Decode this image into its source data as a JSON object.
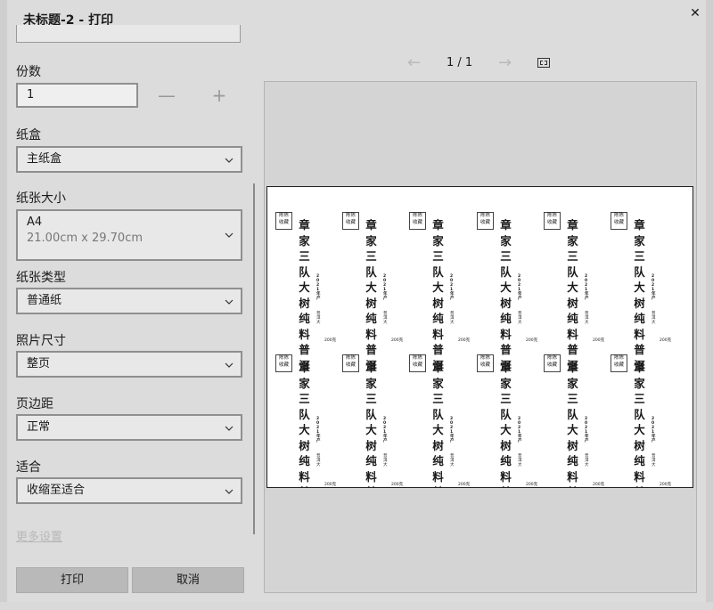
{
  "window": {
    "title": "未标题-2 - 打印",
    "close_glyph": "✕"
  },
  "settings": {
    "copies": {
      "label": "份数",
      "value": "1",
      "minus": "—",
      "plus": "+"
    },
    "tray": {
      "label": "纸盒",
      "value": "主纸盒"
    },
    "paper_size": {
      "label": "纸张大小",
      "value": "A4",
      "sub": "21.00cm x 29.70cm"
    },
    "paper_type": {
      "label": "纸张类型",
      "value": "普通纸"
    },
    "photo_size": {
      "label": "照片尺寸",
      "value": "整页"
    },
    "margins": {
      "label": "页边距",
      "value": "正常"
    },
    "fit": {
      "label": "适合",
      "value": "收缩至适合"
    },
    "more_settings": "更多设置"
  },
  "buttons": {
    "print": "打印",
    "cancel": "取消"
  },
  "preview_nav": {
    "prev": "←",
    "next": "→",
    "page": "1 / 1",
    "fit_icon": "fit-to-window-icon"
  },
  "label": {
    "stamp": "陈陈\n收藏",
    "text": "章家三队大树纯料普洱",
    "year": "2021年\n产",
    "maker": "普洱大",
    "weight": "200克"
  },
  "icons": {
    "chevron": "chevron-down-icon"
  }
}
